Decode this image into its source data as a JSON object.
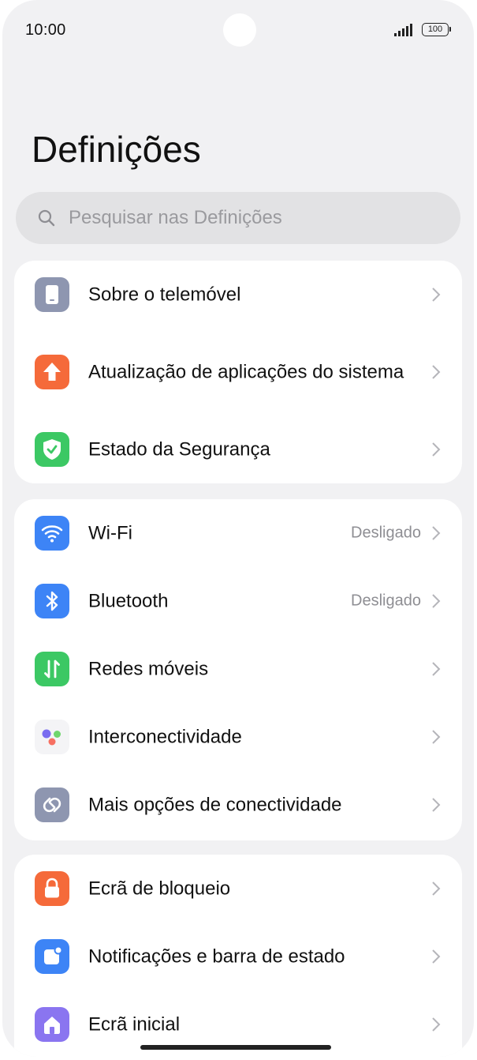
{
  "status_bar": {
    "time": "10:00",
    "battery": "100"
  },
  "header": {
    "title": "Definições"
  },
  "search": {
    "placeholder": "Pesquisar nas Definições",
    "icon": "search-icon"
  },
  "groups": [
    {
      "items": [
        {
          "label": "Sobre o telemóvel",
          "icon": "phone-icon",
          "color": "#8e96b0"
        },
        {
          "label": "Atualização de aplicações do sistema",
          "icon": "arrow-up-icon",
          "color": "#f56a3a"
        },
        {
          "label": "Estado da Segurança",
          "icon": "shield-check-icon",
          "color": "#3cc864"
        }
      ]
    },
    {
      "items": [
        {
          "label": "Wi-Fi",
          "value": "Desligado",
          "icon": "wifi-icon",
          "color": "#3d84f6"
        },
        {
          "label": "Bluetooth",
          "value": "Desligado",
          "icon": "bluetooth-icon",
          "color": "#3d84f6"
        },
        {
          "label": "Redes móveis",
          "icon": "mobile-data-icon",
          "color": "#3cc864"
        },
        {
          "label": "Interconectividade",
          "icon": "interconnect-icon",
          "color": "#f4f4f6"
        },
        {
          "label": "Mais opções de conectividade",
          "icon": "link-icon",
          "color": "#8e96b0"
        }
      ]
    },
    {
      "items": [
        {
          "label": "Ecrã de bloqueio",
          "icon": "lock-icon",
          "color": "#f56a3a"
        },
        {
          "label": "Notificações e barra de estado",
          "icon": "notification-icon",
          "color": "#3d84f6"
        },
        {
          "label": "Ecrã inicial",
          "icon": "home-icon",
          "color": "#8a75f0"
        }
      ]
    }
  ]
}
